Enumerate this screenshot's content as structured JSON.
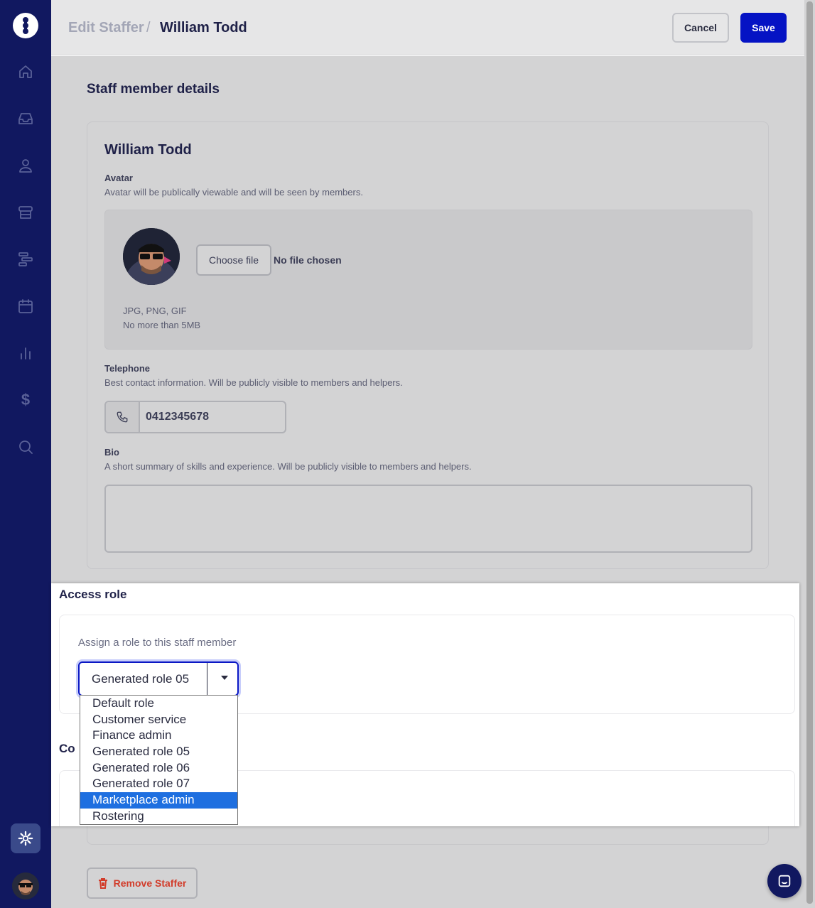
{
  "header": {
    "breadcrumb_parent": "Edit Staffer",
    "breadcrumb_separator": "/",
    "breadcrumb_current": "William Todd",
    "cancel_label": "Cancel",
    "save_label": "Save"
  },
  "sidebar": {
    "items": [
      {
        "icon": "home-icon"
      },
      {
        "icon": "inbox-icon"
      },
      {
        "icon": "user-icon"
      },
      {
        "icon": "store-icon"
      },
      {
        "icon": "workflow-icon"
      },
      {
        "icon": "calendar-icon"
      },
      {
        "icon": "chart-icon"
      },
      {
        "icon": "dollar-icon",
        "glyph": "$"
      },
      {
        "icon": "search-icon"
      }
    ],
    "settings_icon": "gear-icon"
  },
  "details": {
    "section_title": "Staff member details",
    "staff_name": "William Todd",
    "avatar_label": "Avatar",
    "avatar_help": "Avatar will be publically viewable and will be seen by members.",
    "choose_file_label": "Choose file",
    "no_file_text": "No file chosen",
    "formats": "JPG, PNG, GIF",
    "max_size": "No more than 5MB",
    "telephone_label": "Telephone",
    "telephone_help": "Best contact information. Will be publicly visible to members and helpers.",
    "telephone_value": "0412345678",
    "bio_label": "Bio",
    "bio_help": "A short summary of skills and experience. Will be publicly visible to members and helpers.",
    "bio_value": ""
  },
  "access_role": {
    "title": "Access role",
    "help": "Assign a role to this staff member",
    "selected": "Generated role 05",
    "options": [
      "Default role",
      "Customer service",
      "Finance admin",
      "Generated role 05",
      "Generated role 06",
      "Generated role 07",
      "Marketplace admin",
      "Rostering"
    ],
    "highlighted_option": "Marketplace admin"
  },
  "next_section": {
    "title_partial": "Co"
  },
  "footer": {
    "remove_label": "Remove Staffer"
  },
  "colors": {
    "sidebar": "#111860",
    "primary": "#0513c4",
    "danger": "#d23c2a",
    "highlight": "#1e6fe0"
  }
}
